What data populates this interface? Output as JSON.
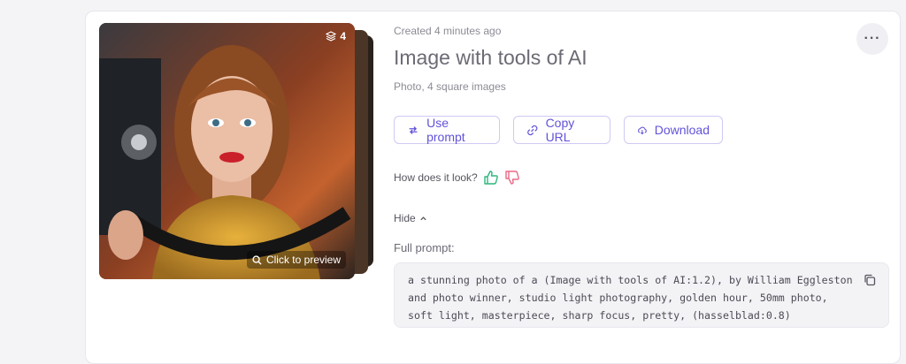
{
  "image": {
    "count_badge": "4",
    "preview_label": "Click to preview"
  },
  "details": {
    "created": "Created 4 minutes ago",
    "title": "Image with tools of AI",
    "subtitle": "Photo, 4 square images",
    "more_label": "···"
  },
  "actions": {
    "use_prompt": "Use prompt",
    "copy_url": "Copy URL",
    "download": "Download"
  },
  "feedback": {
    "question": "How does it look?",
    "up_color": "#2fb67e",
    "down_color": "#e86a86"
  },
  "prompt": {
    "hide_label": "Hide",
    "label": "Full prompt:",
    "text": "a stunning photo of a (Image with tools of AI:1.2), by William Eggleston and photo winner, studio light photography, golden hour, 50mm photo, soft light, masterpiece, sharp focus, pretty, (hasselblad:0.8)"
  },
  "colors": {
    "accent": "#6152d9",
    "button_border": "#cfcaf3"
  }
}
